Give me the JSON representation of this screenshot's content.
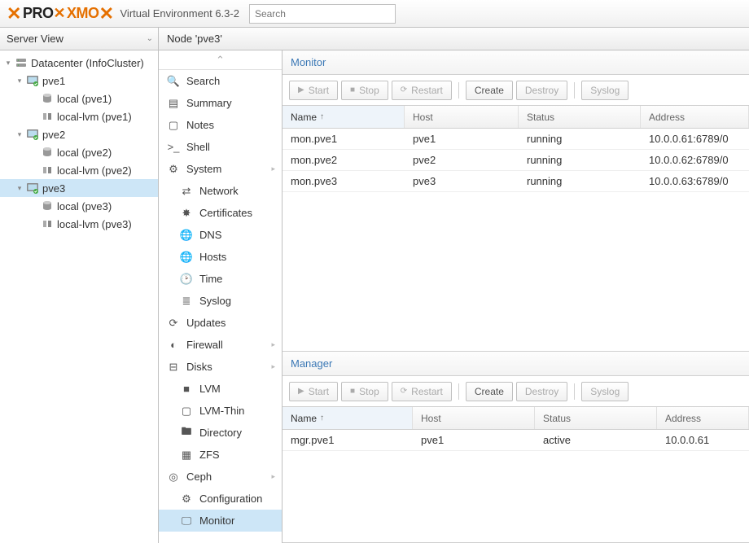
{
  "header": {
    "brand_pro": "PRO",
    "brand_xmo": "XMO",
    "version": "Virtual Environment 6.3-2",
    "search_placeholder": "Search"
  },
  "toolbar": {
    "server_view": "Server View",
    "node_title": "Node 'pve3'"
  },
  "tree": {
    "datacenter": "Datacenter (InfoCluster)",
    "nodes": [
      {
        "name": "pve1",
        "storages": [
          "local (pve1)",
          "local-lvm (pve1)"
        ]
      },
      {
        "name": "pve2",
        "storages": [
          "local (pve2)",
          "local-lvm (pve2)"
        ]
      },
      {
        "name": "pve3",
        "storages": [
          "local (pve3)",
          "local-lvm (pve3)"
        ]
      }
    ],
    "selected_node": "pve3"
  },
  "nav": {
    "search": "Search",
    "summary": "Summary",
    "notes": "Notes",
    "shell": "Shell",
    "system": "System",
    "network": "Network",
    "certificates": "Certificates",
    "dns": "DNS",
    "hosts": "Hosts",
    "time": "Time",
    "syslog": "Syslog",
    "updates": "Updates",
    "firewall": "Firewall",
    "disks": "Disks",
    "lvm": "LVM",
    "lvmthin": "LVM-Thin",
    "directory": "Directory",
    "zfs": "ZFS",
    "ceph": "Ceph",
    "configuration": "Configuration",
    "monitor": "Monitor"
  },
  "buttons": {
    "start": "Start",
    "stop": "Stop",
    "restart": "Restart",
    "create": "Create",
    "destroy": "Destroy",
    "syslog": "Syslog"
  },
  "columns": {
    "name": "Name",
    "host": "Host",
    "status": "Status",
    "address": "Address"
  },
  "monitor": {
    "title": "Monitor",
    "rows": [
      {
        "name": "mon.pve1",
        "host": "pve1",
        "status": "running",
        "address": "10.0.0.61:6789/0"
      },
      {
        "name": "mon.pve2",
        "host": "pve2",
        "status": "running",
        "address": "10.0.0.62:6789/0"
      },
      {
        "name": "mon.pve3",
        "host": "pve3",
        "status": "running",
        "address": "10.0.0.63:6789/0"
      }
    ]
  },
  "manager": {
    "title": "Manager",
    "rows": [
      {
        "name": "mgr.pve1",
        "host": "pve1",
        "status": "active",
        "address": "10.0.0.61"
      }
    ]
  }
}
